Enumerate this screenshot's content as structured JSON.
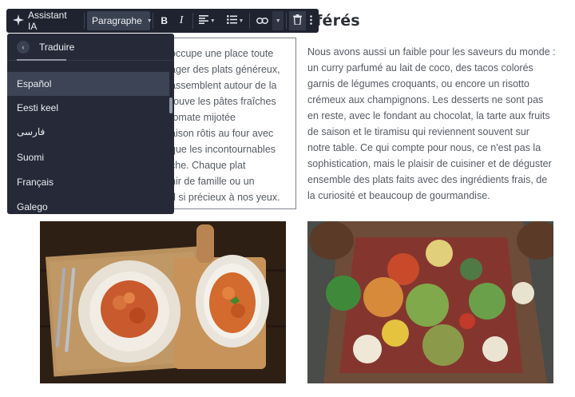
{
  "page": {
    "heading": "éférés",
    "left_column_lines": [
      "occupe une place toute",
      "ager des plats généreux,",
      "assemblent autour de la",
      "rouve les pâtes fraîches",
      "tomate mijotée",
      "aison rôtis au four avec",
      "que les incontournables",
      "che. Chaque plat",
      "nir de famille ou un",
      "d si précieux à nos yeux."
    ],
    "right_column_lines": [
      "Nous avons aussi un faible pour les saveurs du monde :",
      "un curry parfumé au lait de coco, des tacos colorés",
      "garnis de légumes croquants, ou encore un risotto",
      "crémeux aux champignons. Les desserts ne sont pas",
      "en reste, avec le fondant au chocolat, la tarte aux fruits",
      "de saison et le tiramisu qui reviennent souvent sur",
      "notre table. Ce qui compte pour nous, ce n'est pas la",
      "sophistication, mais le plaisir de cuisiner et de déguster",
      "ensemble des plats faits avec des ingrédients frais, de",
      "la curiosité et beaucoup de gourmandise."
    ]
  },
  "toolbar": {
    "ai_label": "Assistant IA",
    "paragraph_label": "Paragraphe",
    "bold_label": "B",
    "italic_label": "I",
    "icons": [
      "sparkle-icon",
      "align-icon",
      "list-icon",
      "link-icon",
      "trash-icon",
      "more-icon"
    ]
  },
  "dropdown": {
    "title": "Traduire",
    "items": [
      "Español",
      "Eesti keel",
      "فارسی",
      "Suomi",
      "Français",
      "Galego"
    ],
    "selected": "Español"
  },
  "colors": {
    "toolbar_bg": "#1f2330",
    "dropdown_bg": "#262a38",
    "selected_bg": "#3d4455",
    "text": "#555b63",
    "heading": "#2b2f36"
  }
}
